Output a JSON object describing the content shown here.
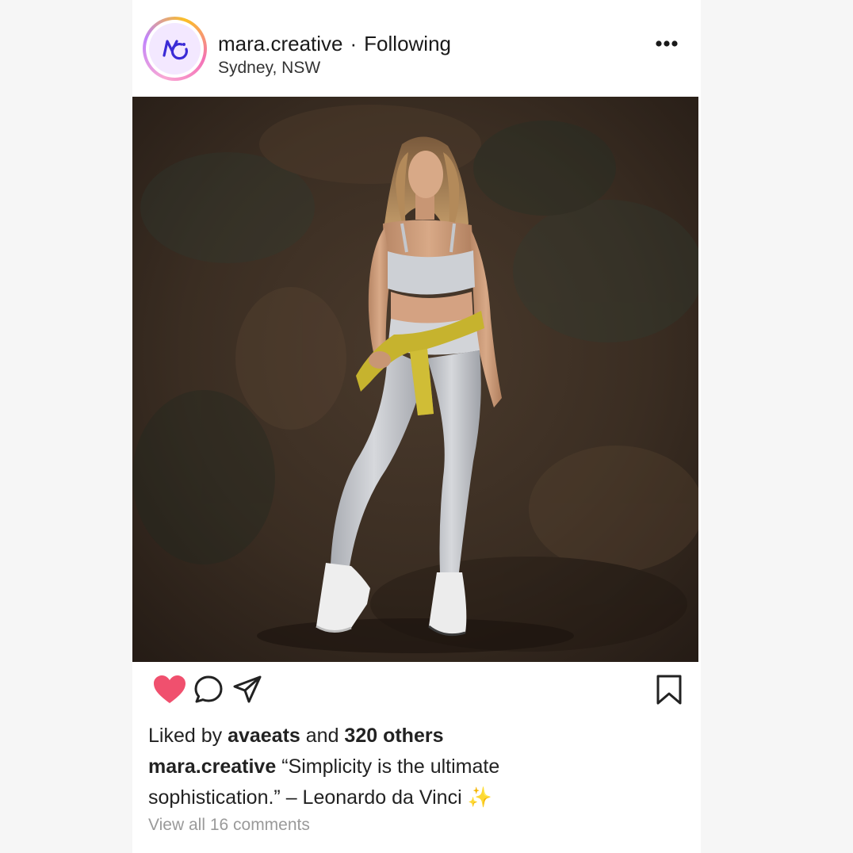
{
  "post": {
    "username": "mara.creative",
    "separator": "·",
    "follow_status": "Following",
    "location": "Sydney, NSW",
    "more_label": "•••",
    "colors": {
      "like_active": "#f0506e",
      "avatar_bg": "#f3e8ff",
      "avatar_logo": "#3b2bd6",
      "muted_text": "#9a9a9a"
    },
    "actions": {
      "like_icon": "heart-filled-icon",
      "comment_icon": "comment-bubble-icon",
      "share_icon": "paper-plane-icon",
      "save_icon": "bookmark-icon",
      "liked": true
    },
    "likes": {
      "prefix": "Liked by ",
      "first_liker": "avaeats",
      "middle": " and ",
      "others": "320 others"
    },
    "caption": {
      "author": "mara.creative",
      "text": "“Simplicity is the ultimate sophistication.” – Leonardo da Vinci",
      "emoji": "✨"
    },
    "comments_link": "View all 16 comments"
  }
}
